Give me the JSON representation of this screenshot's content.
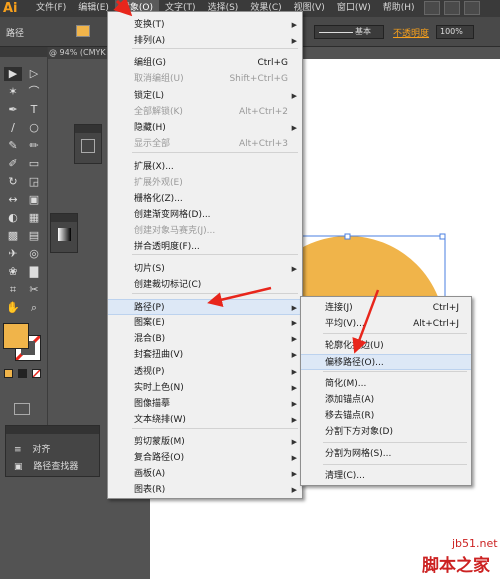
{
  "app": {
    "logo": "Ai"
  },
  "menubar": {
    "items": [
      "文件(F)",
      "编辑(E)",
      "对象(O)",
      "文字(T)",
      "选择(S)",
      "效果(C)",
      "视图(V)",
      "窗口(W)",
      "帮助(H)"
    ]
  },
  "controlbar": {
    "label": "路径",
    "stroke_style": "基本",
    "opacity_label": "不透明度",
    "opacity_value": "100%"
  },
  "document": {
    "tab": "@ 94% (CMYK"
  },
  "object_menu": {
    "items": [
      {
        "label": "变换(T)",
        "shortcut": "",
        "submenu": true,
        "disabled": false
      },
      {
        "label": "排列(A)",
        "shortcut": "",
        "submenu": true,
        "disabled": false
      },
      {
        "label": "编组(G)",
        "shortcut": "Ctrl+G",
        "submenu": false,
        "disabled": false
      },
      {
        "label": "取消编组(U)",
        "shortcut": "Shift+Ctrl+G",
        "submenu": false,
        "disabled": true
      },
      {
        "label": "锁定(L)",
        "shortcut": "",
        "submenu": true,
        "disabled": false
      },
      {
        "label": "全部解锁(K)",
        "shortcut": "Alt+Ctrl+2",
        "submenu": false,
        "disabled": true
      },
      {
        "label": "隐藏(H)",
        "shortcut": "",
        "submenu": true,
        "disabled": false
      },
      {
        "label": "显示全部",
        "shortcut": "Alt+Ctrl+3",
        "submenu": false,
        "disabled": true
      },
      {
        "label": "扩展(X)...",
        "shortcut": "",
        "submenu": false,
        "disabled": false
      },
      {
        "label": "扩展外观(E)",
        "shortcut": "",
        "submenu": false,
        "disabled": true
      },
      {
        "label": "栅格化(Z)...",
        "shortcut": "",
        "submenu": false,
        "disabled": false
      },
      {
        "label": "创建渐变网格(D)...",
        "shortcut": "",
        "submenu": false,
        "disabled": false
      },
      {
        "label": "创建对象马赛克(J)...",
        "shortcut": "",
        "submenu": false,
        "disabled": true
      },
      {
        "label": "拼合透明度(F)...",
        "shortcut": "",
        "submenu": false,
        "disabled": false
      },
      {
        "label": "切片(S)",
        "shortcut": "",
        "submenu": true,
        "disabled": false
      },
      {
        "label": "创建裁切标记(C)",
        "shortcut": "",
        "submenu": false,
        "disabled": false
      },
      {
        "label": "路径(P)",
        "shortcut": "",
        "submenu": true,
        "disabled": false
      },
      {
        "label": "图案(E)",
        "shortcut": "",
        "submenu": true,
        "disabled": false
      },
      {
        "label": "混合(B)",
        "shortcut": "",
        "submenu": true,
        "disabled": false
      },
      {
        "label": "封套扭曲(V)",
        "shortcut": "",
        "submenu": true,
        "disabled": false
      },
      {
        "label": "透视(P)",
        "shortcut": "",
        "submenu": true,
        "disabled": false
      },
      {
        "label": "实时上色(N)",
        "shortcut": "",
        "submenu": true,
        "disabled": false
      },
      {
        "label": "图像描摹",
        "shortcut": "",
        "submenu": true,
        "disabled": false
      },
      {
        "label": "文本绕排(W)",
        "shortcut": "",
        "submenu": true,
        "disabled": false
      },
      {
        "label": "剪切蒙版(M)",
        "shortcut": "",
        "submenu": true,
        "disabled": false
      },
      {
        "label": "复合路径(O)",
        "shortcut": "",
        "submenu": true,
        "disabled": false
      },
      {
        "label": "画板(A)",
        "shortcut": "",
        "submenu": true,
        "disabled": false
      },
      {
        "label": "图表(R)",
        "shortcut": "",
        "submenu": true,
        "disabled": false
      }
    ]
  },
  "path_menu": {
    "items": [
      {
        "label": "连接(J)",
        "shortcut": "Ctrl+J"
      },
      {
        "label": "平均(V)...",
        "shortcut": "Alt+Ctrl+J"
      },
      {
        "label": "轮廓化描边(U)",
        "shortcut": ""
      },
      {
        "label": "偏移路径(O)...",
        "shortcut": ""
      },
      {
        "label": "简化(M)...",
        "shortcut": ""
      },
      {
        "label": "添加锚点(A)",
        "shortcut": ""
      },
      {
        "label": "移去锚点(R)",
        "shortcut": ""
      },
      {
        "label": "分割下方对象(D)",
        "shortcut": ""
      },
      {
        "label": "分割为网格(S)...",
        "shortcut": ""
      },
      {
        "label": "清理(C)...",
        "shortcut": ""
      }
    ]
  },
  "pathfinder_panel": {
    "items": [
      "对齐",
      "路径查找器"
    ]
  },
  "colors": {
    "fill": "#f0b44a",
    "accent": "#f7a01c",
    "highlight": "#dde8f6",
    "arrow": "#e8261c"
  },
  "watermark": {
    "url": "jb51.net",
    "name": "脚本之家"
  }
}
